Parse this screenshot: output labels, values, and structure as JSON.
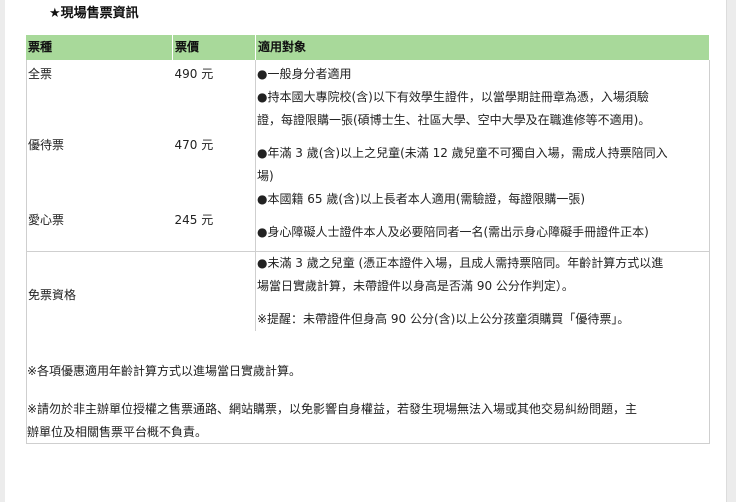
{
  "heading": "★現場售票資訊",
  "table": {
    "headers": [
      "票種",
      "票價",
      "適用對象"
    ],
    "rows": {
      "full": {
        "type": "全票",
        "price": "490 元",
        "desc": [
          "●一般身分者適用"
        ]
      },
      "discount": {
        "type": "優待票",
        "price": "470 元",
        "desc": [
          "●持本國大專院校(含)以下有效學生證件，以當學期註冊章為憑，入場須驗",
          "證，每證限購一張(碩博士生、社區大學、空中大學及在職進修等不適用)。",
          "●年滿 3 歲(含)以上之兒童(未滿 12 歲兒童不可獨自入場，需成人持票陪同入",
          "場)"
        ]
      },
      "love": {
        "type": "愛心票",
        "price": "245 元",
        "desc": [
          "●本國籍 65 歲(含)以上長者本人適用(需驗證，每證限購一張)",
          "●身心障礙人士證件本人及必要陪同者一名(需出示身心障礙手冊證件正本)"
        ]
      },
      "free": {
        "type": "免票資格",
        "desc": [
          "●未滿 3 歲之兒童 (憑正本證件入場，且成人需持票陪同。年齡計算方式以進",
          "場當日實歲計算，未帶證件以身高是否滿 90 公分作判定）。",
          "※提醒：未帶證件但身高 90 公分(含)以上公分孩童須購買「優待票」。"
        ]
      }
    }
  },
  "notes": [
    "※各項優惠適用年齡計算方式以進場當日實歲計算。",
    "※請勿於非主辦單位授權之售票通路、網站購票，以免影響自身權益，若發生現場無法入場或其他交易糾紛問題，主",
    "辦單位及相關售票平台概不負責。"
  ]
}
